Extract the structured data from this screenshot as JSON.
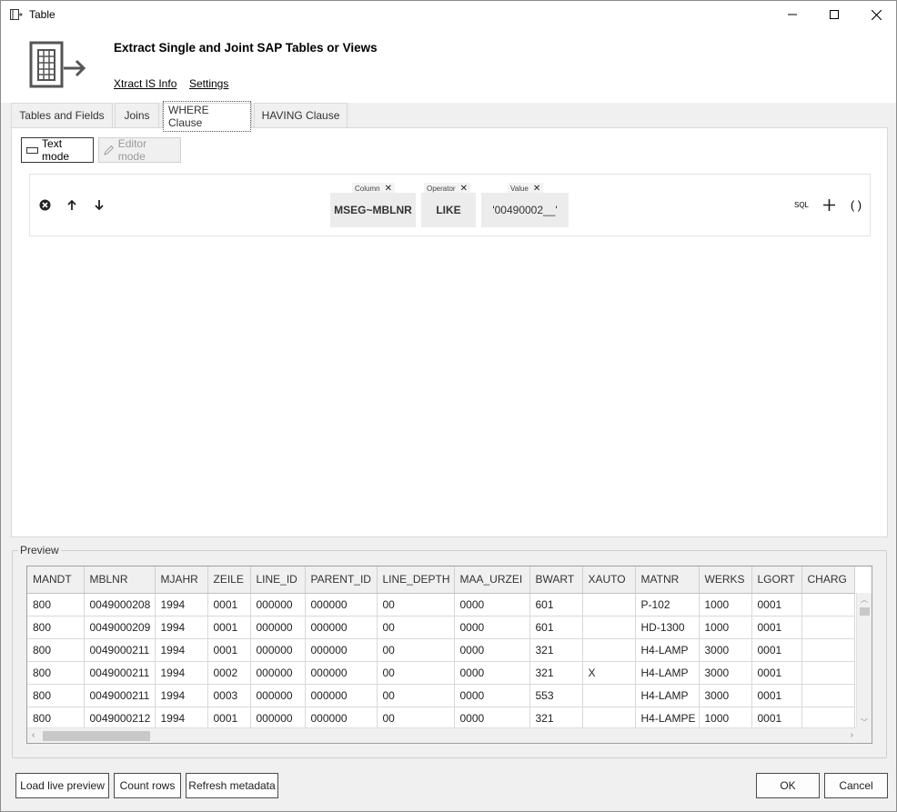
{
  "window": {
    "title": "Table"
  },
  "header": {
    "title": "Extract Single and Joint SAP Tables or Views",
    "link_info": "Xtract IS Info",
    "link_settings": "Settings"
  },
  "tabs": [
    {
      "label": "Tables and Fields"
    },
    {
      "label": "Joins"
    },
    {
      "label": "WHERE Clause",
      "active": true
    },
    {
      "label": "HAVING Clause"
    }
  ],
  "modes": {
    "text": "Text mode",
    "editor": "Editor mode"
  },
  "condition": {
    "column_caption": "Column",
    "column_value": "MSEG~MBLNR",
    "operator_caption": "Operator",
    "operator_value": "LIKE",
    "value_caption": "Value",
    "value_value": "'00490002__'",
    "sql_label": "SQL",
    "paren_label": "( )"
  },
  "preview": {
    "label": "Preview",
    "columns": [
      "MANDT",
      "MBLNR",
      "MJAHR",
      "ZEILE",
      "LINE_ID",
      "PARENT_ID",
      "LINE_DEPTH",
      "MAA_URZEI",
      "BWART",
      "XAUTO",
      "MATNR",
      "WERKS",
      "LGORT",
      "CHARG"
    ],
    "rows": [
      [
        "800",
        "0049000208",
        "1994",
        "0001",
        "000000",
        "000000",
        "00",
        "0000",
        "601",
        "",
        "P-102",
        "1000",
        "0001",
        ""
      ],
      [
        "800",
        "0049000209",
        "1994",
        "0001",
        "000000",
        "000000",
        "00",
        "0000",
        "601",
        "",
        "HD-1300",
        "1000",
        "0001",
        ""
      ],
      [
        "800",
        "0049000211",
        "1994",
        "0001",
        "000000",
        "000000",
        "00",
        "0000",
        "321",
        "",
        "H4-LAMP",
        "3000",
        "0001",
        ""
      ],
      [
        "800",
        "0049000211",
        "1994",
        "0002",
        "000000",
        "000000",
        "00",
        "0000",
        "321",
        "X",
        "H4-LAMP",
        "3000",
        "0001",
        ""
      ],
      [
        "800",
        "0049000211",
        "1994",
        "0003",
        "000000",
        "000000",
        "00",
        "0000",
        "553",
        "",
        "H4-LAMP",
        "3000",
        "0001",
        ""
      ],
      [
        "800",
        "0049000212",
        "1994",
        "0001",
        "000000",
        "000000",
        "00",
        "0000",
        "321",
        "",
        "H4-LAMPE",
        "1000",
        "0001",
        ""
      ]
    ]
  },
  "buttons": {
    "load_live": "Load live preview",
    "count_rows": "Count rows",
    "refresh_metadata": "Refresh metadata",
    "ok": "OK",
    "cancel": "Cancel"
  }
}
